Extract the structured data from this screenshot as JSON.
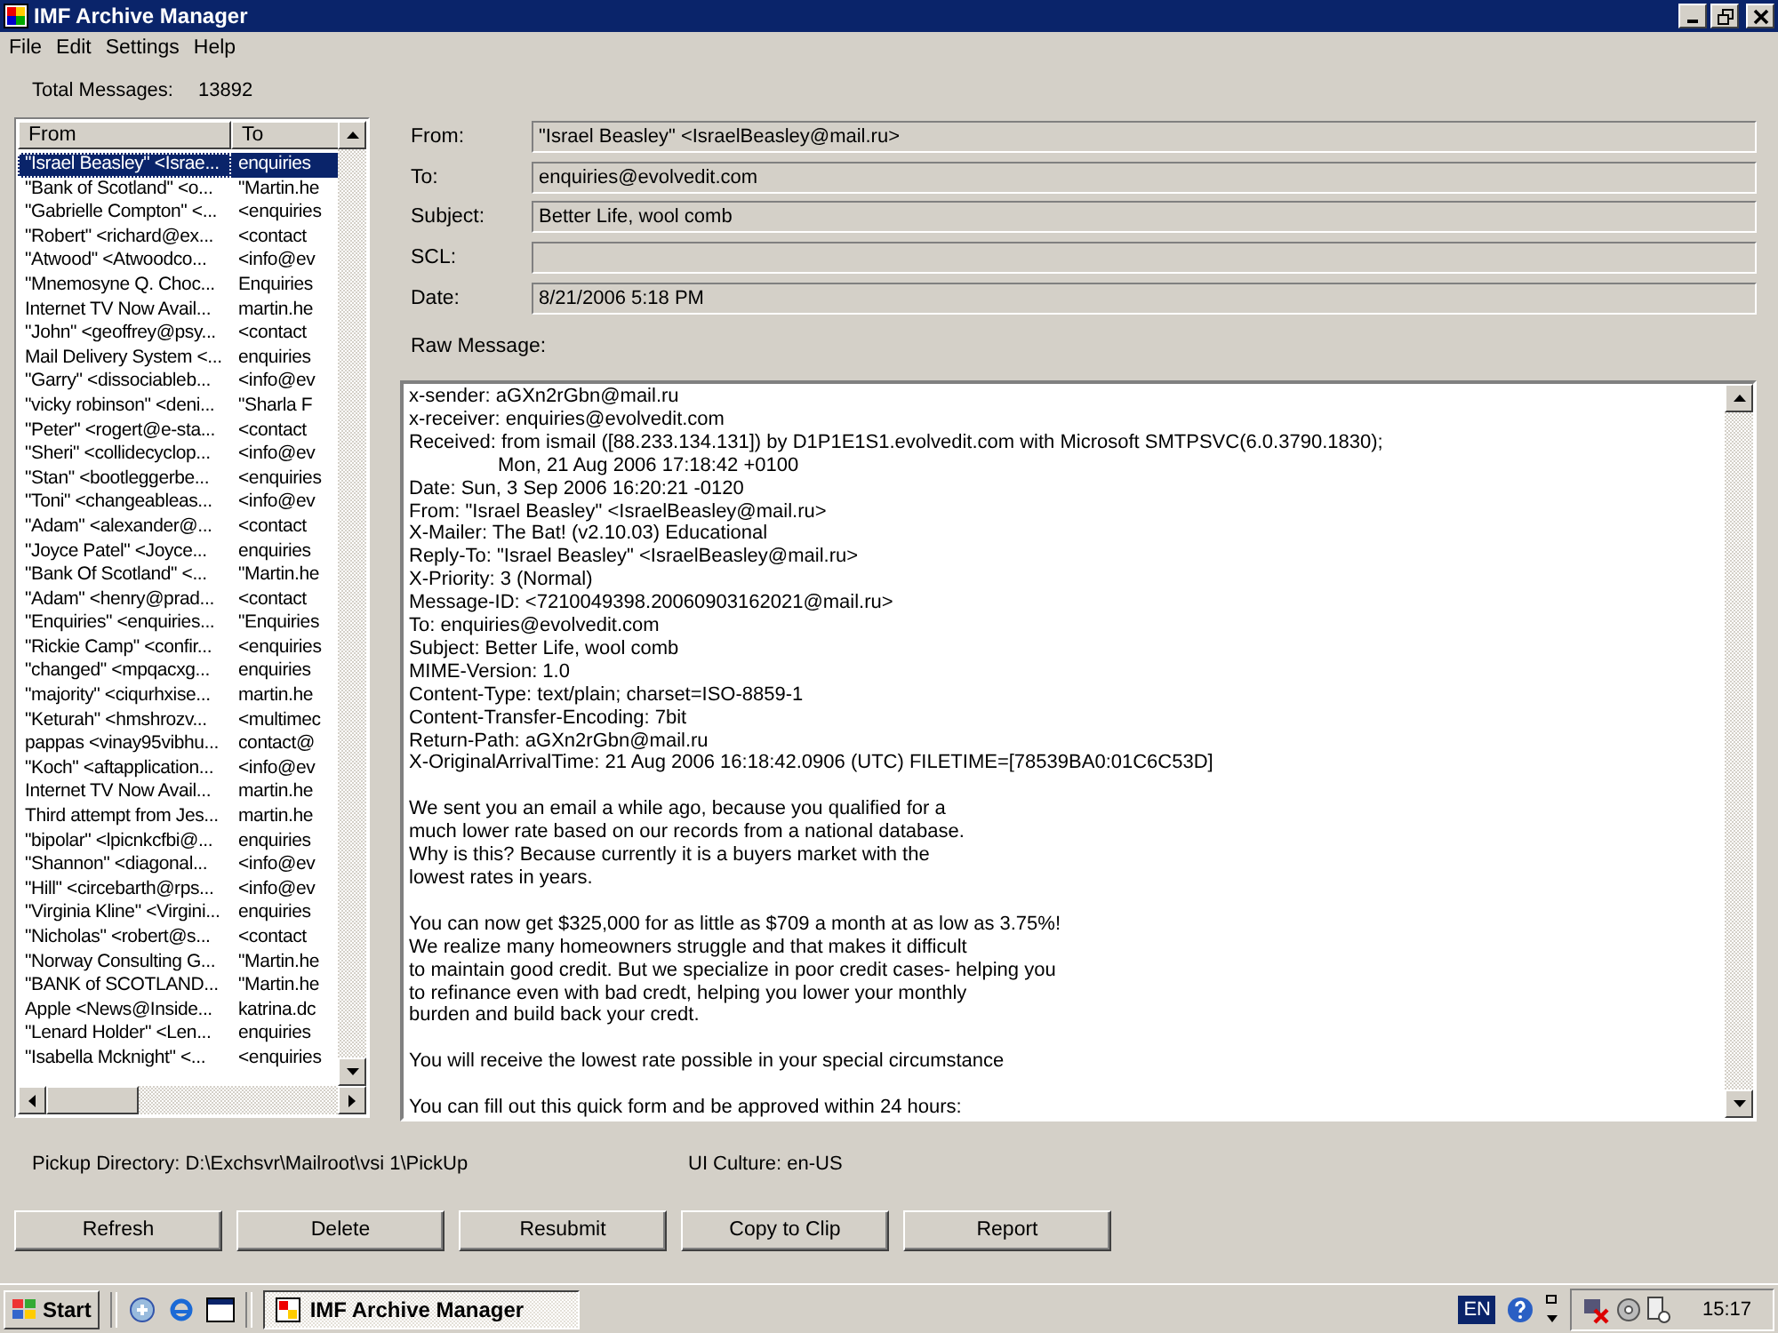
{
  "window": {
    "title": "IMF Archive Manager"
  },
  "menu": [
    "File",
    "Edit",
    "Settings",
    "Help"
  ],
  "total_messages": {
    "label": "Total Messages:",
    "value": "13892"
  },
  "message_list": {
    "columns": [
      "From",
      "To"
    ],
    "rows": [
      {
        "from": "\"Israel Beasley\" <Israe...",
        "to": "enquiries",
        "selected": true
      },
      {
        "from": "\"Bank of Scotland\" <o...",
        "to": "\"Martin.he",
        "selected": false
      },
      {
        "from": "\"Gabrielle Compton\" <...",
        "to": "<enquiries",
        "selected": false
      },
      {
        "from": "\"Robert\" <richard@ex...",
        "to": "<contact",
        "selected": false
      },
      {
        "from": "\"Atwood\" <Atwoodco...",
        "to": "<info@ev",
        "selected": false
      },
      {
        "from": "\"Mnemosyne Q. Choc...",
        "to": "Enquiries",
        "selected": false
      },
      {
        "from": "Internet TV Now Avail...",
        "to": "martin.he",
        "selected": false
      },
      {
        "from": "\"John\" <geoffrey@psy...",
        "to": "<contact",
        "selected": false
      },
      {
        "from": "Mail Delivery System <...",
        "to": "enquiries",
        "selected": false
      },
      {
        "from": "\"Garry\" <dissociableb...",
        "to": "<info@ev",
        "selected": false
      },
      {
        "from": "\"vicky robinson\" <deni...",
        "to": "\"Sharla F",
        "selected": false
      },
      {
        "from": "\"Peter\" <rogert@e-sta...",
        "to": "<contact",
        "selected": false
      },
      {
        "from": "\"Sheri\" <collidecyclop...",
        "to": "<info@ev",
        "selected": false
      },
      {
        "from": "\"Stan\" <bootleggerbe...",
        "to": "<enquiries",
        "selected": false
      },
      {
        "from": "\"Toni\" <changeableas...",
        "to": "<info@ev",
        "selected": false
      },
      {
        "from": "\"Adam\" <alexander@...",
        "to": "<contact",
        "selected": false
      },
      {
        "from": "\"Joyce Patel\" <Joyce...",
        "to": "enquiries",
        "selected": false
      },
      {
        "from": "\"Bank Of Scotland\" <...",
        "to": "\"Martin.he",
        "selected": false
      },
      {
        "from": "\"Adam\" <henry@prad...",
        "to": "<contact",
        "selected": false
      },
      {
        "from": "\"Enquiries\" <enquiries...",
        "to": "\"Enquiries",
        "selected": false
      },
      {
        "from": "\"Rickie Camp\" <confir...",
        "to": "<enquiries",
        "selected": false
      },
      {
        "from": "\"changed\" <mpqacxg...",
        "to": "enquiries",
        "selected": false
      },
      {
        "from": "\"majority\" <ciqurhxise...",
        "to": "martin.he",
        "selected": false
      },
      {
        "from": "\"Keturah\" <hmshrozv...",
        "to": "<multimec",
        "selected": false
      },
      {
        "from": "pappas <vinay95vibhu...",
        "to": "contact@",
        "selected": false
      },
      {
        "from": "\"Koch\" <aftapplication...",
        "to": "<info@ev",
        "selected": false
      },
      {
        "from": "Internet TV Now Avail...",
        "to": "martin.he",
        "selected": false
      },
      {
        "from": "Third attempt from Jes...",
        "to": "martin.he",
        "selected": false
      },
      {
        "from": "\"bipolar\" <lpicnkcfbi@...",
        "to": "enquiries",
        "selected": false
      },
      {
        "from": "\"Shannon\" <diagonal...",
        "to": "<info@ev",
        "selected": false
      },
      {
        "from": "\"Hill\" <circebarth@rps...",
        "to": "<info@ev",
        "selected": false
      },
      {
        "from": "\"Virginia Kline\" <Virgini...",
        "to": "enquiries",
        "selected": false
      },
      {
        "from": "\"Nicholas\" <robert@s...",
        "to": "<contact",
        "selected": false
      },
      {
        "from": "\"Norway Consulting G...",
        "to": "\"Martin.he",
        "selected": false
      },
      {
        "from": "\"BANK of SCOTLAND...",
        "to": "\"Martin.he",
        "selected": false
      },
      {
        "from": "Apple <News@Inside...",
        "to": "katrina.dc",
        "selected": false
      },
      {
        "from": "\"Lenard Holder\" <Len...",
        "to": "enquiries",
        "selected": false
      },
      {
        "from": "\"Isabella Mcknight\" <...",
        "to": "<enquiries",
        "selected": false
      }
    ]
  },
  "fields": [
    {
      "label": "From:",
      "value": "\"Israel Beasley\" <IsraelBeasley@mail.ru>"
    },
    {
      "label": "To:",
      "value": "enquiries@evolvedit.com"
    },
    {
      "label": "Subject:",
      "value": "Better Life, wool comb"
    },
    {
      "label": "SCL:"
    },
    {
      "label": "Date:",
      "value": "8/21/2006 5:18 PM"
    }
  ],
  "raw_message": {
    "label": "Raw Message:",
    "header_lines": [
      {
        "text": "x-sender: aGXn2rGbn@mail.ru",
        "continuation": false
      },
      {
        "text": "x-receiver: enquiries@evolvedit.com",
        "continuation": false
      },
      {
        "text": "Received: from ismail ([88.233.134.131]) by D1P1E1S1.evolvedit.com with Microsoft SMTPSVC(6.0.3790.1830);",
        "continuation": false
      },
      {
        "text": "Mon, 21 Aug 2006 17:18:42 +0100",
        "continuation": true
      },
      {
        "text": "Date: Sun, 3 Sep 2006 16:20:21 -0120",
        "continuation": false
      },
      {
        "text": "From: \"Israel Beasley\" <IsraelBeasley@mail.ru>",
        "continuation": false
      },
      {
        "text": "X-Mailer: The Bat! (v2.10.03) Educational",
        "continuation": false
      },
      {
        "text": "Reply-To: \"Israel Beasley\" <IsraelBeasley@mail.ru>",
        "continuation": false
      },
      {
        "text": "X-Priority: 3 (Normal)",
        "continuation": false
      },
      {
        "text": "Message-ID: <7210049398.20060903162021@mail.ru>",
        "continuation": false
      },
      {
        "text": "To: enquiries@evolvedit.com",
        "continuation": false
      },
      {
        "text": "Subject: Better Life, wool comb",
        "continuation": false
      },
      {
        "text": "MIME-Version: 1.0",
        "continuation": false
      },
      {
        "text": "Content-Type: text/plain; charset=ISO-8859-1",
        "continuation": false
      },
      {
        "text": "Content-Transfer-Encoding: 7bit",
        "continuation": false
      },
      {
        "text": "Return-Path: aGXn2rGbn@mail.ru",
        "continuation": false
      },
      {
        "text": "X-OriginalArrivalTime: 21 Aug 2006 16:18:42.0906 (UTC) FILETIME=[78539BA0:01C6C53D]",
        "continuation": false
      }
    ],
    "paragraphs": [
      [
        "We sent you an email a while ago, because you qualified for a",
        "much lower rate based on our records from a national database.",
        "Why is this? Because currently it is a buyers market with the",
        "lowest rates in years."
      ],
      [
        "You can now get $325,000 for as little as $709 a month at as low as 3.75%!",
        "We realize many homeowners struggle and that makes it difficult",
        "to maintain good credit. But we specialize in poor credit cases- helping you",
        "to refinance even with bad credt, helping you lower your monthly",
        "burden and build back your credt."
      ],
      [
        "You will receive the lowest rate possible in your special circumstance"
      ],
      [
        "You can fill out this quick form and be approved within 24 hours:"
      ]
    ]
  },
  "pickup_directory": "Pickup Directory: D:\\Exchsvr\\Mailroot\\vsi 1\\PickUp",
  "ui_culture": "UI Culture: en-US",
  "buttons": [
    "Refresh",
    "Delete",
    "Resubmit",
    "Copy to Clip",
    "Report"
  ],
  "taskbar": {
    "start": "Start",
    "tasks": [
      {
        "label": "IMF Archive Manager",
        "selected": true
      }
    ],
    "language": "EN",
    "clock": "15:17"
  }
}
